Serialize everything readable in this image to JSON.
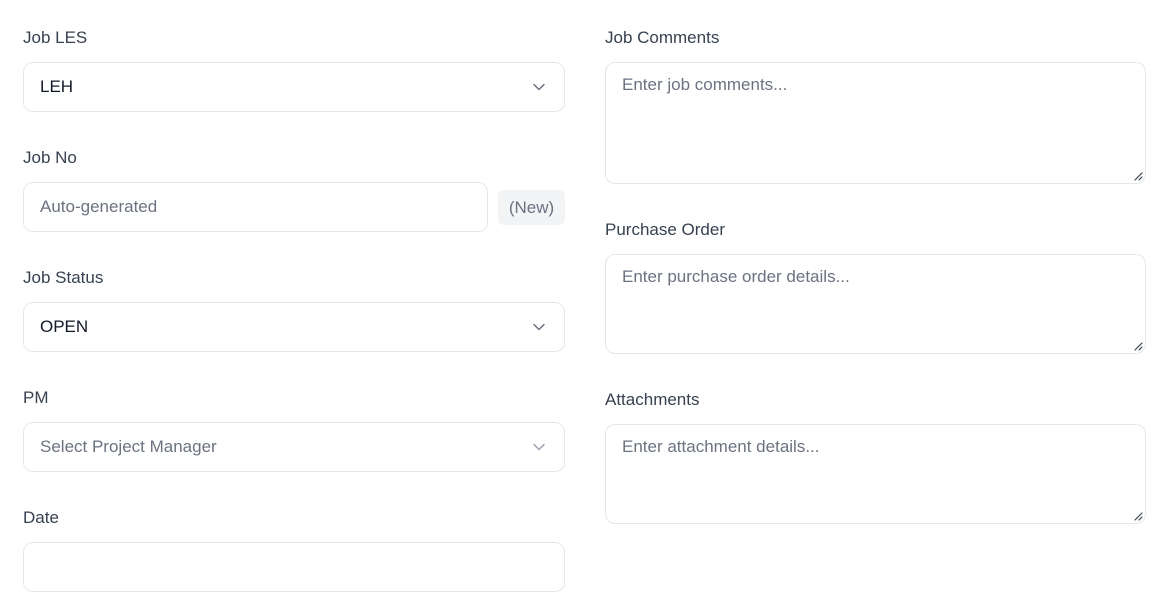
{
  "form": {
    "job_les": {
      "label": "Job LES",
      "value": "LEH",
      "icon": "chevron-down-icon"
    },
    "job_no": {
      "label": "Job No",
      "placeholder": "Auto-generated",
      "badge": "(New)"
    },
    "job_status": {
      "label": "Job Status",
      "value": "OPEN",
      "icon": "chevron-down-icon"
    },
    "pm": {
      "label": "PM",
      "placeholder": "Select Project Manager",
      "icon": "chevron-down-icon"
    },
    "date": {
      "label": "Date"
    },
    "job_comments": {
      "label": "Job Comments",
      "placeholder": "Enter job comments..."
    },
    "purchase_order": {
      "label": "Purchase Order",
      "placeholder": "Enter purchase order details..."
    },
    "attachments": {
      "label": "Attachments",
      "placeholder": "Enter attachment details..."
    }
  },
  "colors": {
    "border": "#e5e7eb",
    "label": "#374151",
    "placeholder": "#6b7280",
    "value": "#111827",
    "badge_bg": "#f3f4f6"
  }
}
